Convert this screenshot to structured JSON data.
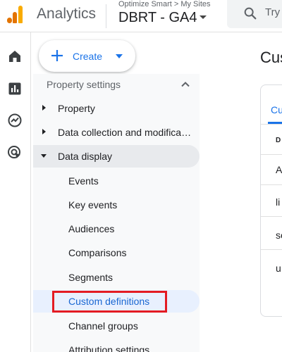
{
  "header": {
    "app_title": "Analytics",
    "breadcrumb": "Optimize Smart > My Sites",
    "property_name": "DBRT - GA4",
    "search_placeholder": "Try"
  },
  "rail": {
    "icons": [
      "home-icon",
      "reports-icon",
      "explore-icon",
      "advertising-icon"
    ]
  },
  "create_button": {
    "label": "Create"
  },
  "nav": {
    "section_title": "Property settings",
    "items": [
      {
        "label": "Property",
        "expanded": false
      },
      {
        "label": "Data collection and modifica…",
        "expanded": false
      },
      {
        "label": "Data display",
        "expanded": true
      }
    ],
    "sub_items": [
      "Events",
      "Key events",
      "Audiences",
      "Comparisons",
      "Segments",
      "Custom definitions",
      "Channel groups",
      "Attribution settings"
    ],
    "active_sub_item": "Custom definitions"
  },
  "main": {
    "page_title": "Cus",
    "tab_label": "Cu",
    "column_header": "D",
    "rows": [
      "A",
      "li",
      "se",
      "u"
    ]
  },
  "colors": {
    "accent": "#1a73e8",
    "highlight_border": "#e31b23",
    "active_bg": "#e8f0fe"
  }
}
